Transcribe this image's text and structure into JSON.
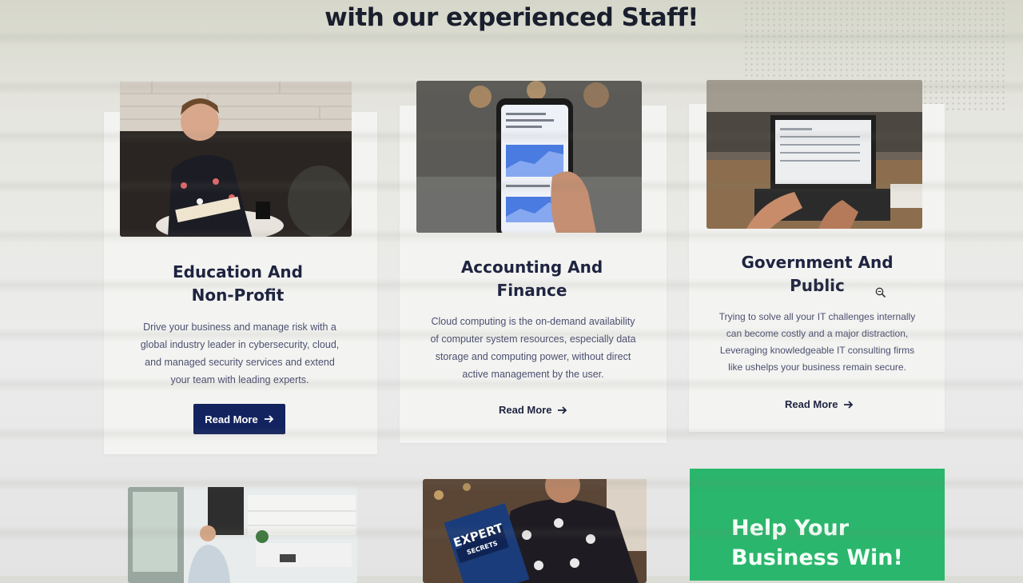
{
  "section": {
    "headline": "with our experienced Staff!"
  },
  "cards": [
    {
      "title_line1": "Education And",
      "title_line2": "Non-Profit",
      "text_lines": [
        "Drive your business and manage risk with a",
        "global industry leader in cybersecurity, cloud,",
        "and managed security services and extend",
        "your team with leading experts."
      ],
      "cta": "Read More",
      "cta_icon": "arrow-right-icon"
    },
    {
      "title_line1": "Accounting And",
      "title_line2": "Finance",
      "text_lines": [
        "Cloud computing is the on-demand availability",
        "of computer system resources, especially data",
        "storage and computing power, without direct",
        "active management by the user."
      ],
      "cta": "Read More",
      "cta_icon": "arrow-right-icon"
    },
    {
      "title_line1": "Government And",
      "title_line2": "Public",
      "text_lines": [
        "Trying to solve all your IT challenges internally",
        "can become costly and a major distraction,",
        "Leveraging knowledgeable IT consulting firms",
        "like ushelps your business remain secure."
      ],
      "cta": "Read More",
      "cta_icon": "arrow-right-icon"
    }
  ],
  "promo": {
    "line1": "Help Your",
    "line2": "Business Win!"
  },
  "book": {
    "cover_text_1": "EXPERT",
    "cover_text_2": "SECRETS"
  },
  "colors": {
    "primary_button": "#13235f",
    "promo_green": "#2ab66c",
    "heading": "#1e2440"
  }
}
